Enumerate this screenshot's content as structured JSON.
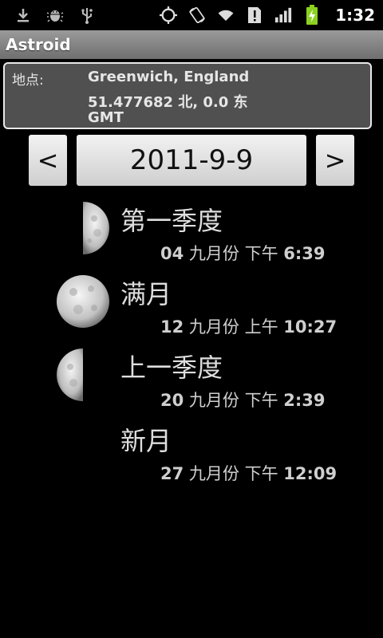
{
  "statusbar": {
    "time": "1:32",
    "icons": [
      "download-icon",
      "android-debug-icon",
      "usb-icon",
      "gps-icon",
      "rotate-icon",
      "wifi-icon",
      "alert-icon",
      "signal-icon",
      "battery-charging-icon"
    ]
  },
  "app": {
    "title": "Astroid"
  },
  "location": {
    "label": "地点:",
    "name": "Greenwich, England",
    "coords": "51.477682 北, 0.0 东",
    "timezone": "GMT"
  },
  "date_nav": {
    "prev_label": "<",
    "date": "2011-9-9",
    "next_label": ">"
  },
  "phases": [
    {
      "name": "第一季度",
      "day": "04",
      "month": "九月份",
      "ampm": "下午",
      "time": "6:39",
      "icon": "first-quarter-moon-icon"
    },
    {
      "name": "满月",
      "day": "12",
      "month": "九月份",
      "ampm": "上午",
      "time": "10:27",
      "icon": "full-moon-icon"
    },
    {
      "name": "上一季度",
      "day": "20",
      "month": "九月份",
      "ampm": "下午",
      "time": "2:39",
      "icon": "last-quarter-moon-icon"
    },
    {
      "name": "新月",
      "day": "27",
      "month": "九月份",
      "ampm": "下午",
      "time": "12:09",
      "icon": "new-moon-icon"
    }
  ],
  "colors": {
    "background": "#000000",
    "titlebar": "#8a8a8a",
    "panel": "#505050",
    "button": "#e0e0e0",
    "charging": "#8bd122"
  }
}
